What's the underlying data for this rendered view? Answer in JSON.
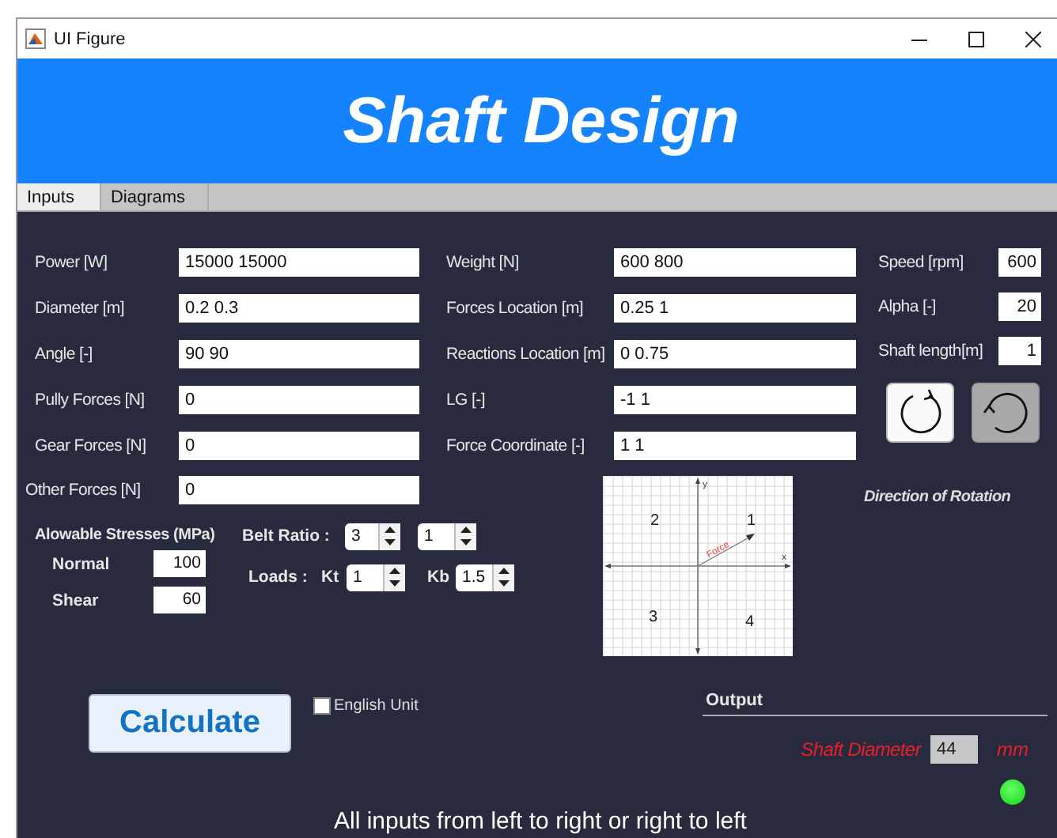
{
  "window": {
    "title": "UI Figure"
  },
  "banner": {
    "title": "Shaft Design"
  },
  "tabs": [
    {
      "label": "Inputs",
      "selected": true
    },
    {
      "label": "Diagrams",
      "selected": false
    }
  ],
  "left_fields": [
    {
      "label": "Power [W]",
      "value": "15000 15000"
    },
    {
      "label": "Diameter [m]",
      "value": "0.2 0.3"
    },
    {
      "label": "Angle [-]",
      "value": "90 90"
    },
    {
      "label": "Pully Forces [N]",
      "value": "0"
    },
    {
      "label": "Gear Forces [N]",
      "value": "0"
    }
  ],
  "other_forces": {
    "label": "Other Forces [N]",
    "value": "0"
  },
  "middle_fields": [
    {
      "label": "Weight [N]",
      "value": "600 800"
    },
    {
      "label": "Forces Location [m]",
      "value": "0.25 1"
    },
    {
      "label": "Reactions Location [m]",
      "value": "0 0.75"
    },
    {
      "label": "LG [-]",
      "value": "-1 1"
    },
    {
      "label": "Force Coordinate [-]",
      "value": "1 1"
    }
  ],
  "right_fields": [
    {
      "label": "Speed [rpm]",
      "value": "600"
    },
    {
      "label": "Alpha [-]",
      "value": "20"
    },
    {
      "label": "Shaft length[m]",
      "value": "1"
    }
  ],
  "rotation": {
    "options": [
      {
        "kind": "clockwise",
        "selected": false
      },
      {
        "kind": "counterclockwise",
        "selected": true
      }
    ],
    "caption": "Direction of Rotation"
  },
  "quadrant_diagram": {
    "axis_labels": [
      "y",
      "x"
    ],
    "quadrant_labels": [
      "2",
      "1",
      "3",
      "4"
    ],
    "force_label": "Force"
  },
  "stresses": {
    "title": "Alowable Stresses (MPa)",
    "fields": [
      {
        "label": "Normal",
        "value": "100"
      },
      {
        "label": "Shear",
        "value": "60"
      }
    ]
  },
  "belt_ratio": {
    "label": "Belt Ratio :",
    "values": [
      "3",
      "1"
    ]
  },
  "loads": {
    "label": "Loads :",
    "spinners": [
      {
        "label": "Kt",
        "value": "1"
      },
      {
        "label": "Kb",
        "value": "1.5"
      }
    ]
  },
  "calculate_button": "Calculate",
  "english_unit": {
    "label": "English Unit",
    "checked": false
  },
  "output": {
    "title": "Output",
    "label": "Shaft Diameter",
    "value": "44",
    "unit": "mm",
    "lamp_on": true
  },
  "footer": "All inputs from left to right or right to left"
}
